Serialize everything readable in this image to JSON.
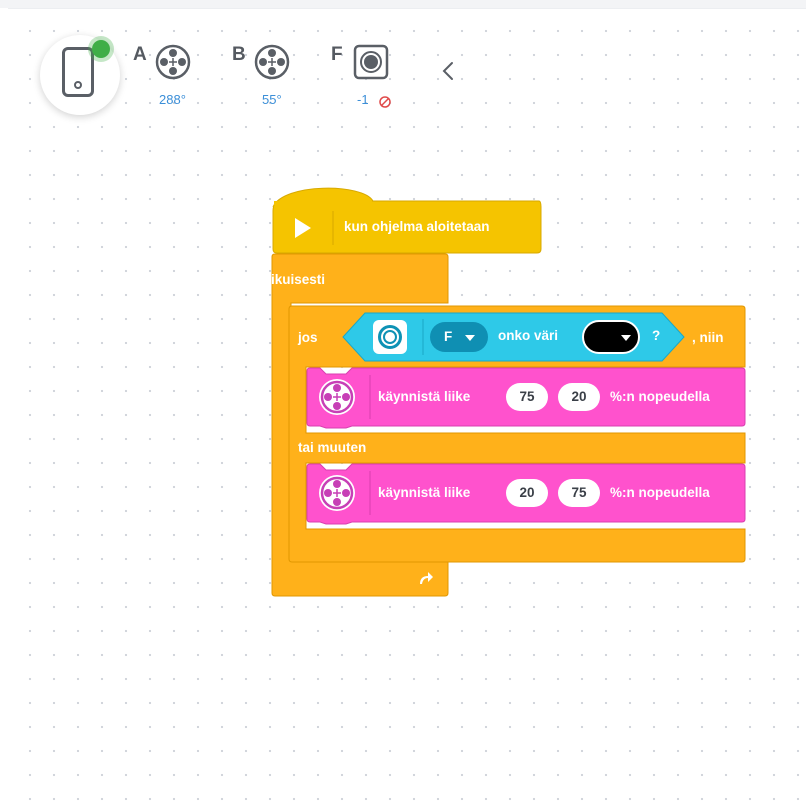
{
  "ports": [
    {
      "letter": "A",
      "value": "288°"
    },
    {
      "letter": "B",
      "value": "55°"
    },
    {
      "letter": "F",
      "value": "-1"
    }
  ],
  "hat": {
    "label": "kun ohjelma aloitetaan"
  },
  "forever": {
    "label": "ikuisesti"
  },
  "if_block": {
    "if_label": "jos",
    "port": "F",
    "condition_label": "onko väri",
    "question": "?",
    "then_label": ", niin",
    "else_label": "tai muuten"
  },
  "motor_block_1": {
    "label": "käynnistä liike",
    "value1": "75",
    "value2": "20",
    "suffix": "%:n nopeudella"
  },
  "motor_block_2": {
    "label": "käynnistä liike",
    "value1": "20",
    "value2": "75",
    "suffix": "%:n nopeudella"
  },
  "colors": {
    "events": "#f5c400",
    "control": "#ffb11a",
    "sensors": "#2ec9e8",
    "motors": "#ff52cd",
    "accent_blue": "#3c8fd8"
  }
}
